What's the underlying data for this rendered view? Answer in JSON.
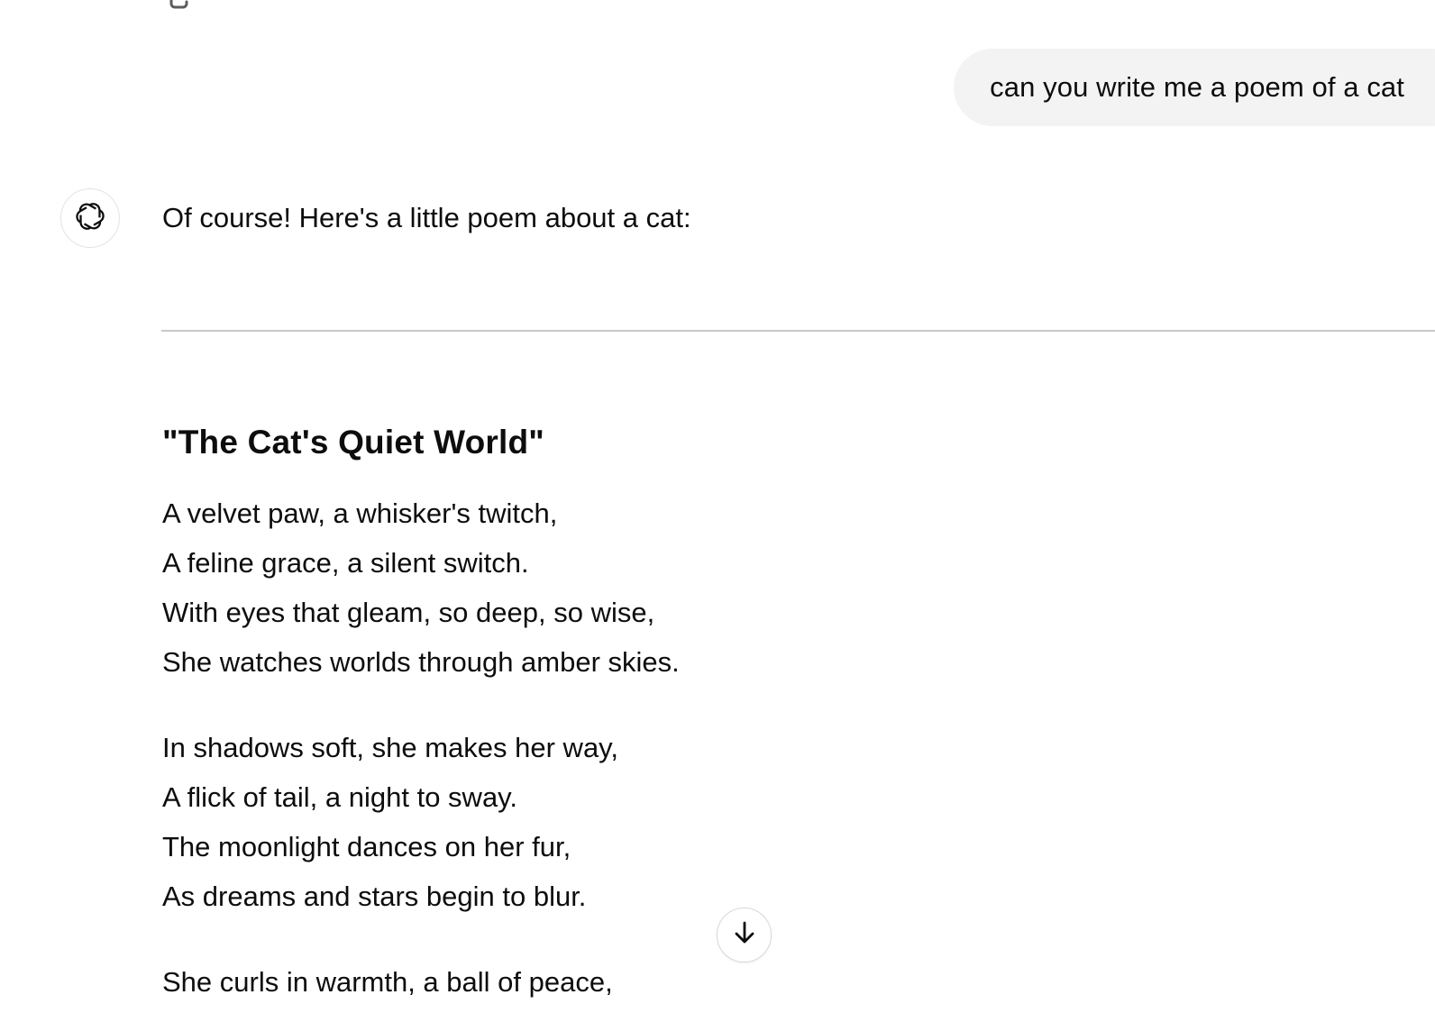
{
  "user_message": {
    "text": "can you write me a poem of a cat"
  },
  "assistant": {
    "avatar_icon": "openai-logo-icon",
    "intro": "Of course! Here's a little poem about a cat:",
    "poem": {
      "title": "\"The Cat's Quiet World\"",
      "stanzas": [
        {
          "lines": [
            "A velvet paw, a whisker's twitch,",
            "A feline grace, a silent switch.",
            "With eyes that gleam, so deep, so wise,",
            "She watches worlds through amber skies."
          ]
        },
        {
          "lines": [
            "In shadows soft, she makes her way,",
            "A flick of tail, a night to sway.",
            "The moonlight dances on her fur,",
            "As dreams and stars begin to blur."
          ]
        },
        {
          "lines": [
            "She curls in warmth, a ball of peace,"
          ]
        }
      ]
    }
  },
  "controls": {
    "copy_icon": "copy-icon",
    "scroll_down_icon": "arrow-down-icon"
  },
  "colors": {
    "user_bubble_bg": "#f3f3f3",
    "text": "#0d0d0d",
    "divider": "#c9c9c9"
  }
}
